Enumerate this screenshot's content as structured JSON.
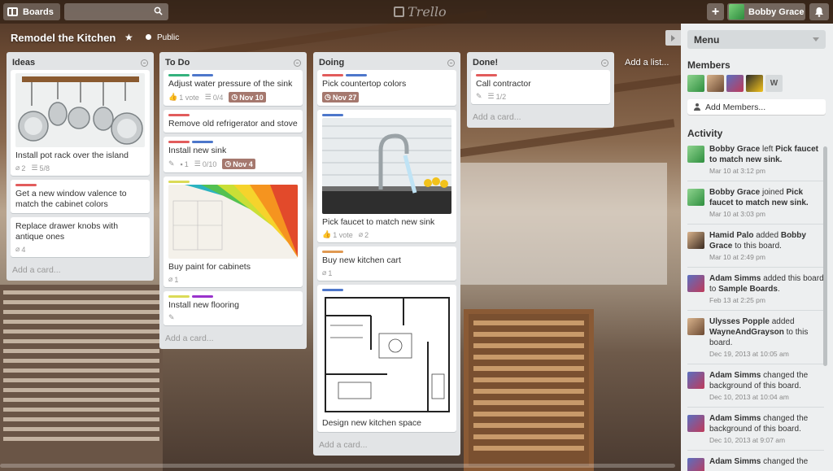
{
  "header": {
    "boards_label": "Boards",
    "logo": "Trello",
    "add_label": "+",
    "user_name": "Bobby Grace"
  },
  "board": {
    "title": "Remodel the Kitchen",
    "star": "★",
    "visibility": "Public",
    "add_list": "Add a list..."
  },
  "lists": [
    {
      "title": "Ideas",
      "cards": [
        {
          "title": "Install pot rack over the island",
          "attachments": "2",
          "checklist": "5/8",
          "cover": "pot-rack"
        },
        {
          "title": "Get a new window valence to match the cabinet colors",
          "labels": [
            "#e25c5c"
          ]
        },
        {
          "title": "Replace drawer knobs with antique ones",
          "attachments": "4"
        }
      ],
      "add_card": "Add a card..."
    },
    {
      "title": "To Do",
      "cards": [
        {
          "title": "Adjust water pressure of the sink",
          "labels": [
            "#34b27d",
            "#4d77cb"
          ],
          "votes": "1 vote",
          "checklist": "0/4",
          "due": "Nov 10"
        },
        {
          "title": "Remove old refrigerator and stove",
          "labels": [
            "#e25c5c"
          ]
        },
        {
          "title": "Install new sink",
          "labels": [
            "#e25c5c",
            "#4d77cb"
          ],
          "comments": "1",
          "checklist": "0/10",
          "due": "Nov 4"
        },
        {
          "title": "Buy paint for cabinets",
          "labels": [
            "#dbdb57"
          ],
          "attachments": "1",
          "cover": "paint"
        },
        {
          "title": "Install new flooring",
          "labels": [
            "#dbdb57",
            "#93c"
          ]
        }
      ],
      "add_card": "Add a card..."
    },
    {
      "title": "Doing",
      "cards": [
        {
          "title": "Pick countertop colors",
          "labels": [
            "#e25c5c",
            "#4d77cb"
          ],
          "due": "Nov 27"
        },
        {
          "title": "Pick faucet to match new sink",
          "labels": [
            "#4d77cb"
          ],
          "votes": "1 vote",
          "attachments": "2",
          "cover": "faucet"
        },
        {
          "title": "Buy new kitchen cart",
          "labels": [
            "#e09952"
          ],
          "attachments": "1"
        },
        {
          "title": "Design new kitchen space",
          "labels": [
            "#4d77cb"
          ],
          "cover": "blueprint"
        }
      ],
      "add_card": "Add a card..."
    },
    {
      "title": "Done!",
      "cards": [
        {
          "title": "Call contractor",
          "labels": [
            "#e25c5c"
          ],
          "checklist": "1/2"
        }
      ],
      "add_card": "Add a card..."
    }
  ],
  "sidebar": {
    "menu_label": "Menu",
    "members_title": "Members",
    "add_members": "Add Members...",
    "activity_title": "Activity",
    "member_initial": "W",
    "activity": [
      {
        "user": "Bobby Grace",
        "text1": " left ",
        "target": "Pick faucet to match new sink.",
        "time": "Mar 10 at 3:12 pm"
      },
      {
        "user": "Bobby Grace",
        "text1": " joined ",
        "target": "Pick faucet to match new sink.",
        "time": "Mar 10 at 3:03 pm"
      },
      {
        "user": "Hamid Palo",
        "text1": " added ",
        "target": "Bobby Grace",
        "text2": " to this board.",
        "time": "Mar 10 at 2:49 pm"
      },
      {
        "user": "Adam Simms",
        "text1": " added this board to ",
        "target": "Sample Boards",
        "text2": ".",
        "time": "Feb 13 at 2:25 pm"
      },
      {
        "user": "Ulysses Popple",
        "text1": " added ",
        "target": "WayneAndGrayson",
        "text2": " to this board.",
        "time": "Dec 19, 2013 at 10:05 am"
      },
      {
        "user": "Adam Simms",
        "text1": " changed the background of this board.",
        "target": "",
        "time": "Dec 10, 2013 at 10:04 am"
      },
      {
        "user": "Adam Simms",
        "text1": " changed the background of this board.",
        "target": "",
        "time": "Dec 10, 2013 at 9:07 am"
      },
      {
        "user": "Adam Simms",
        "text1": " changed the",
        "target": "",
        "time": ""
      }
    ]
  },
  "colors": {
    "list_bg": "#e2e4e6",
    "sidebar_bg": "#edeff0"
  }
}
